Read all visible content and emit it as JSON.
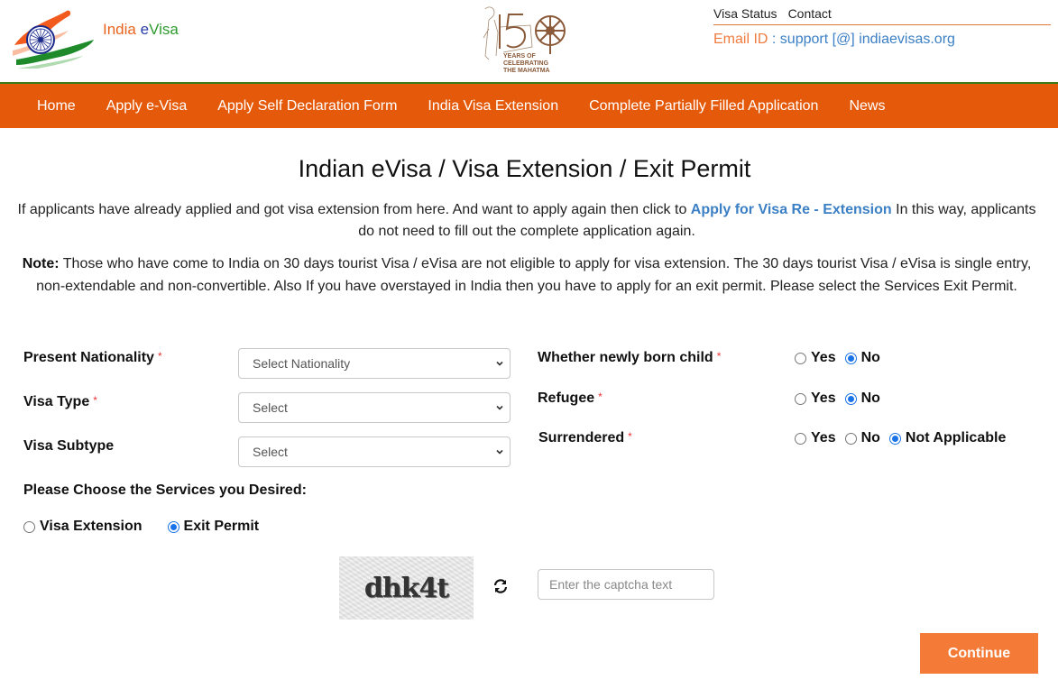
{
  "header": {
    "brand_part1": "India",
    "brand_part2_e": "e",
    "brand_part2_rest": "Visa",
    "anniversary_logo_alt": "150 Years of Celebrating the Mahatma",
    "anniversary_line1": "YEARS OF",
    "anniversary_line2": "CELEBRATING",
    "anniversary_line3": "THE MAHATMA",
    "top_links": [
      "Visa Status",
      "Contact"
    ],
    "email_label": "Email ID",
    "email_separator": " : ",
    "email_value": "support [@] indiaevisas.org"
  },
  "nav": {
    "items": [
      "Home",
      "Apply e-Visa",
      "Apply Self Declaration Form",
      "India Visa Extension",
      "Complete Partially Filled Application",
      "News"
    ]
  },
  "main": {
    "title": "Indian eVisa / Visa Extension / Exit Permit",
    "intro_before": "If applicants have already applied and got visa extension from here. And want to apply again then click to ",
    "intro_link": "Apply for Visa Re - Extension",
    "intro_after": " In this way, applicants do not need to fill out the complete application again.",
    "note_label": "Note:",
    "note_text": " Those who have come to India on 30 days tourist Visa / eVisa are not eligible to apply for visa extension. The 30 days tourist Visa / eVisa is single entry, non-extendable and non-convertible. Also If you have overstayed in India then you have to apply for an exit permit. Please select the Services Exit Permit."
  },
  "form": {
    "required_marker": "*",
    "nationality": {
      "label": "Present Nationality",
      "value": "Select Nationality"
    },
    "visa_type": {
      "label": "Visa Type",
      "value": "Select"
    },
    "visa_subtype": {
      "label": "Visa Subtype",
      "value": "Select"
    },
    "newly_born": {
      "label": "Whether newly born child",
      "options": [
        "Yes",
        "No"
      ],
      "selected": "No"
    },
    "refugee": {
      "label": "Refugee",
      "options": [
        "Yes",
        "No"
      ],
      "selected": "No"
    },
    "surrendered": {
      "label": "Surrendered",
      "options": [
        "Yes",
        "No",
        "Not Applicable"
      ],
      "selected": "Not Applicable"
    },
    "services": {
      "label": "Please Choose the Services you Desired:",
      "options": [
        "Visa Extension",
        "Exit Permit"
      ],
      "selected": "Exit Permit"
    },
    "captcha": {
      "image_text": "dhk4t",
      "input_value": "",
      "input_placeholder": "Enter the captcha text"
    },
    "continue_label": "Continue"
  },
  "colors": {
    "nav_bg": "#e55a0a",
    "nav_top_line": "#3a7a1a",
    "accent_orange": "#f47b37",
    "link_blue": "#3b7fc4",
    "radio_blue": "#1a73e8",
    "required_red": "#ee3333"
  }
}
